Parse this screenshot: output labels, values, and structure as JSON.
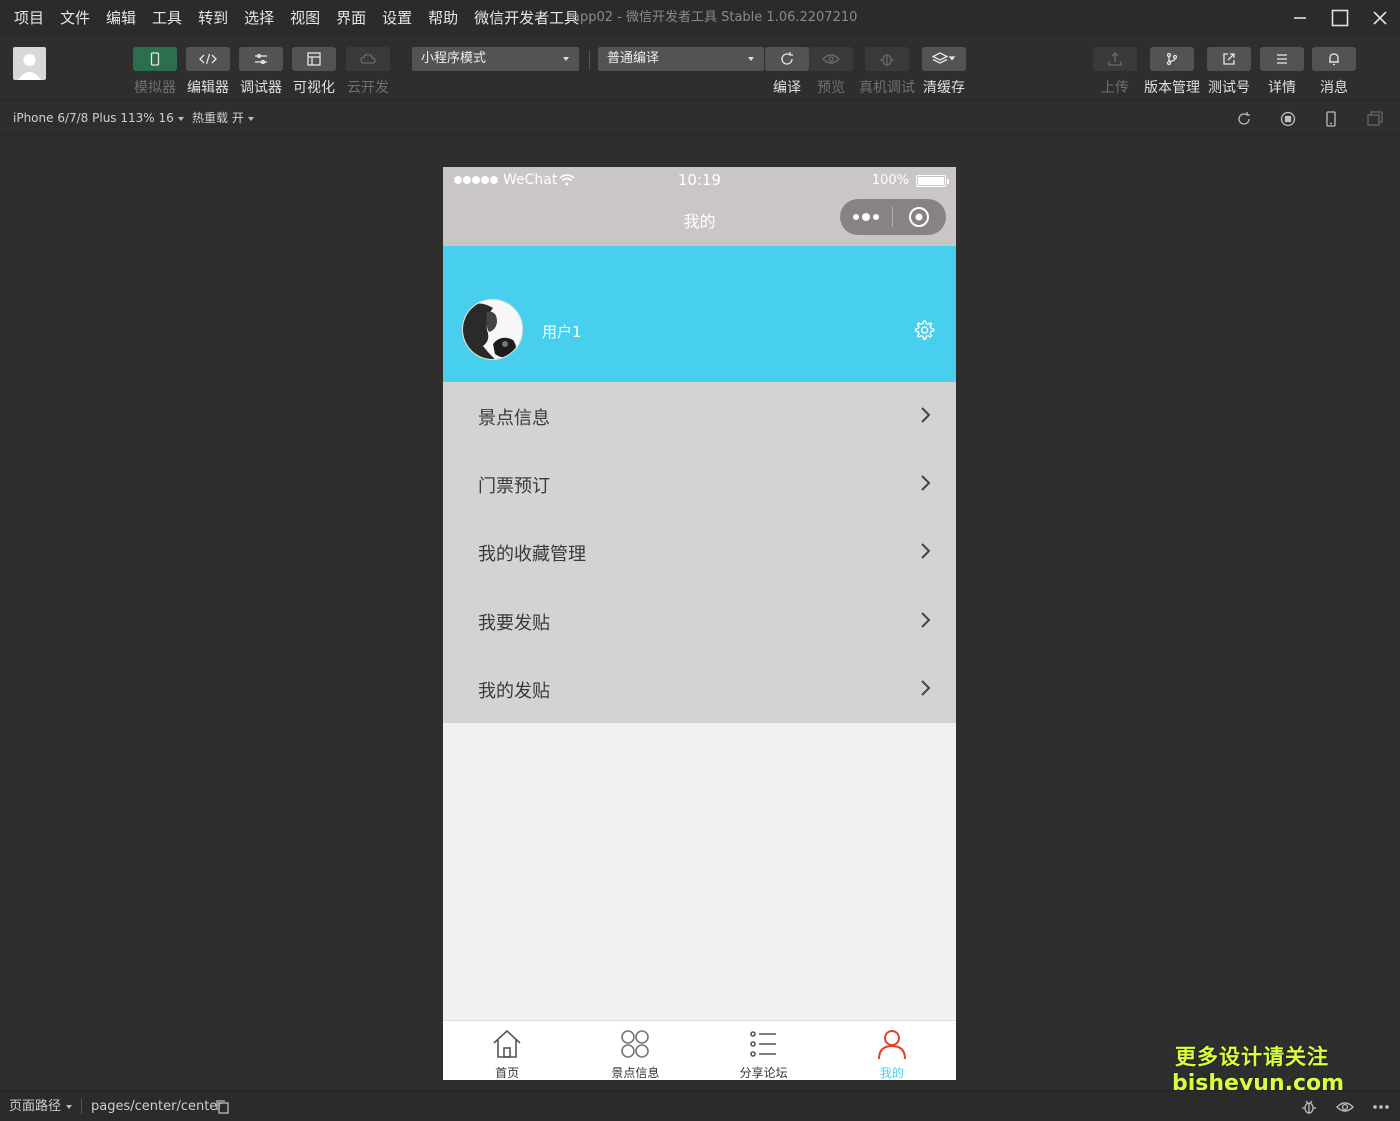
{
  "menubar": {
    "items": [
      "项目",
      "文件",
      "编辑",
      "工具",
      "转到",
      "选择",
      "视图",
      "界面",
      "设置",
      "帮助",
      "微信开发者工具"
    ],
    "window_title": "app02 - 微信开发者工具 Stable 1.06.2207210"
  },
  "toolbar": {
    "simulator": "模拟器",
    "editor": "编辑器",
    "debugger": "调试器",
    "visual": "可视化",
    "cloud": "云开发",
    "mode_select": "小程序模式",
    "compile_select": "普通编译",
    "compile": "编译",
    "preview": "预览",
    "real_debug": "真机调试",
    "clear_cache": "清缓存",
    "upload": "上传",
    "version": "版本管理",
    "test_account": "测试号",
    "details": "详情",
    "messages": "消息"
  },
  "subbar": {
    "device": "iPhone 6/7/8 Plus 113% 16",
    "hot_reload": "热重载 开"
  },
  "phone": {
    "status": {
      "carrier": "WeChat",
      "time": "10:19",
      "battery": "100%"
    },
    "nav_title": "我的",
    "username": "用户1",
    "menu": [
      {
        "label": "景点信息"
      },
      {
        "label": "门票预订"
      },
      {
        "label": "我的收藏管理"
      },
      {
        "label": "我要发贴"
      },
      {
        "label": "我的发贴"
      }
    ],
    "tabs": [
      {
        "label": "首页",
        "icon": "home-icon"
      },
      {
        "label": "景点信息",
        "icon": "grid-icon"
      },
      {
        "label": "分享论坛",
        "icon": "list-icon"
      },
      {
        "label": "我的",
        "icon": "user-icon",
        "active": true
      }
    ],
    "accent": "#48cfee"
  },
  "watermark": {
    "line1": "更多设计请关注",
    "line2": "bisheyun.com"
  },
  "bottombar": {
    "path_label": "页面路径",
    "path": "pages/center/center"
  }
}
